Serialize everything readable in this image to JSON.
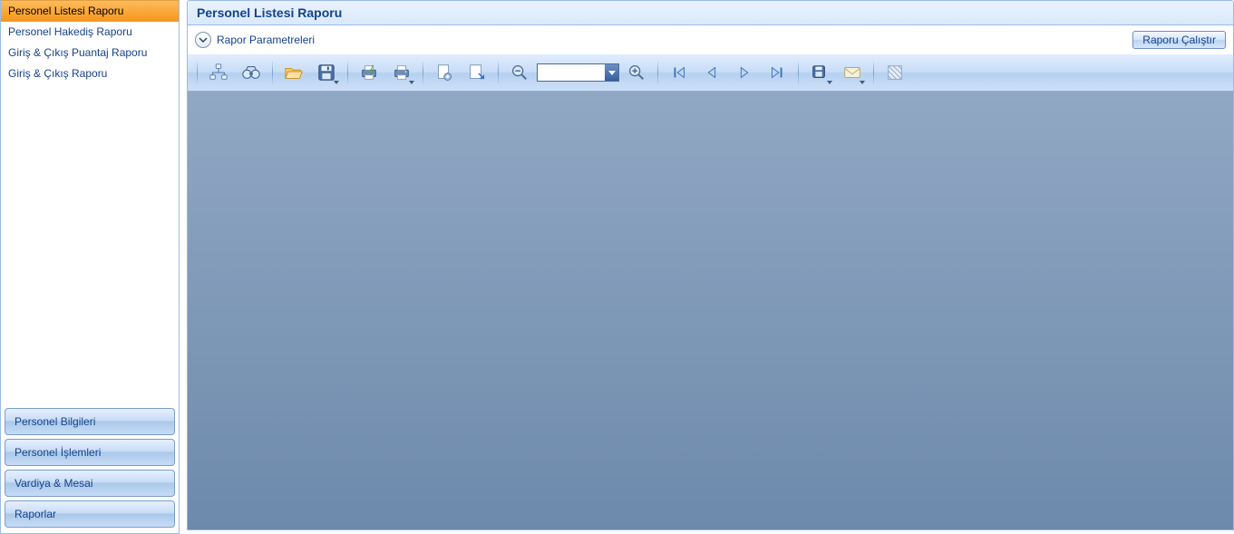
{
  "sidebar": {
    "items": [
      {
        "label": "Personel Listesi Raporu",
        "active": true
      },
      {
        "label": "Personel Hakediş Raporu",
        "active": false
      },
      {
        "label": "Giriş & Çıkış Puantaj Raporu",
        "active": false
      },
      {
        "label": "Giriş & Çıkış Raporu",
        "active": false
      }
    ],
    "nav": [
      {
        "label": "Personel Bilgileri"
      },
      {
        "label": "Personel İşlemleri"
      },
      {
        "label": "Vardiya & Mesai"
      },
      {
        "label": "Raporlar"
      }
    ]
  },
  "header": {
    "title": "Personel Listesi Raporu"
  },
  "params": {
    "label": "Rapor Parametreleri",
    "run_label": "Raporu Çalıştır"
  },
  "toolbar": {
    "zoom_value": ""
  }
}
